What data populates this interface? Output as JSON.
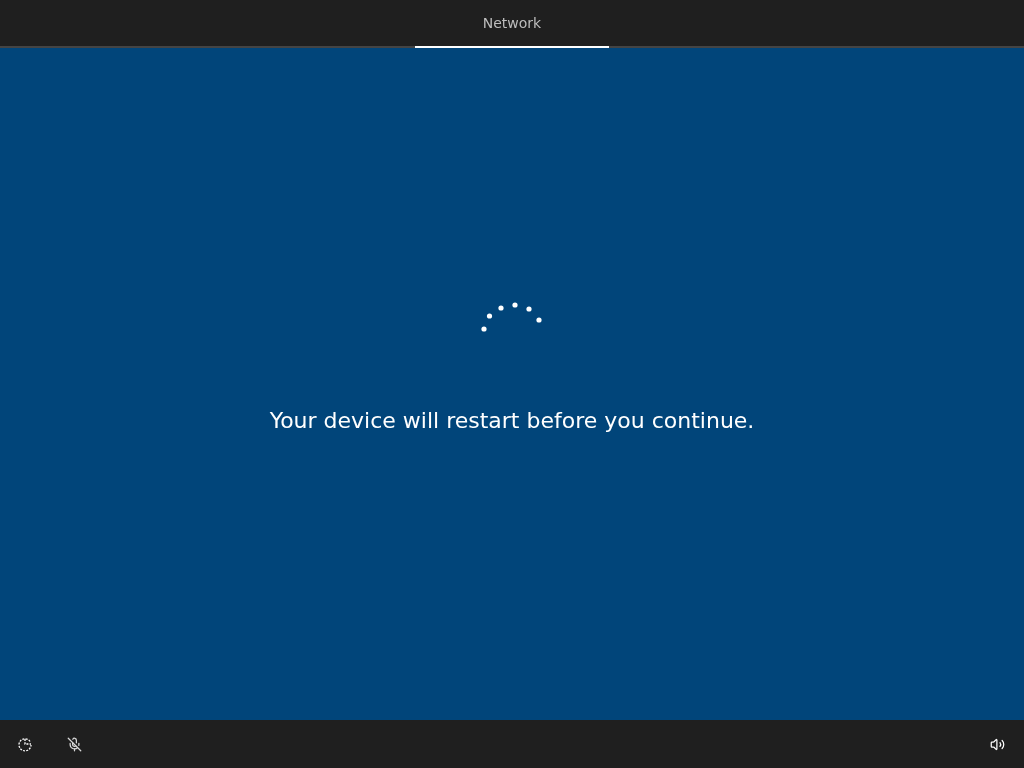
{
  "tabs": [
    {
      "label": "Network",
      "selected": true
    }
  ],
  "message": "Your device will restart before you continue."
}
